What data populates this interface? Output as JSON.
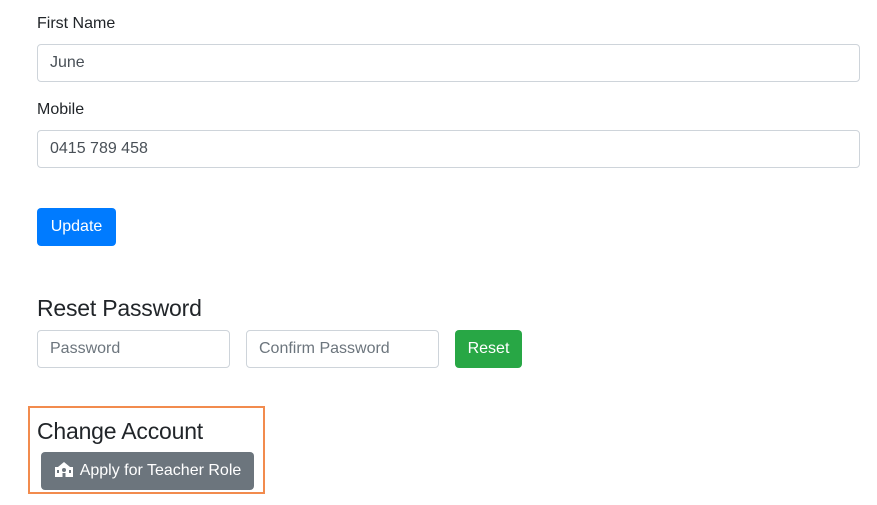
{
  "profile": {
    "first_name_label": "First Name",
    "first_name_value": "June",
    "mobile_label": "Mobile",
    "mobile_value": "0415 789 458",
    "update_label": "Update"
  },
  "reset_password": {
    "heading": "Reset Password",
    "password_placeholder": "Password",
    "confirm_placeholder": "Confirm Password",
    "reset_label": "Reset"
  },
  "change_account": {
    "heading": "Change Account",
    "apply_label": "Apply for Teacher Role",
    "apply_icon": "school-icon"
  },
  "colors": {
    "primary": "#007bff",
    "success": "#28a745",
    "secondary": "#6c757d",
    "highlight": "#f28b4d"
  }
}
